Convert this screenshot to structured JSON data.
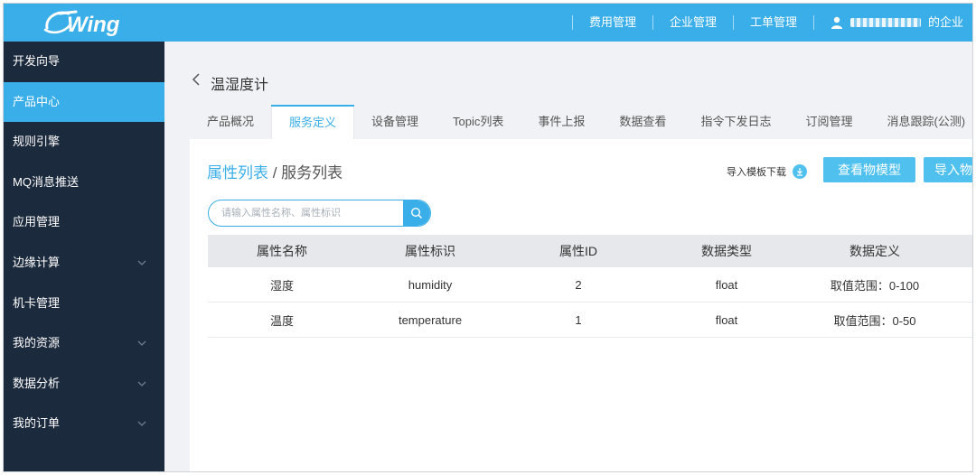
{
  "brand": {
    "logo_text": "Wing",
    "accent": "#3aaee8",
    "sidebar_bg": "#1c2a3d"
  },
  "topnav": {
    "items": [
      "费用管理",
      "企业管理",
      "工单管理"
    ],
    "user_suffix": "的企业"
  },
  "sidebar": {
    "items": [
      {
        "label": "开发向导",
        "expandable": false
      },
      {
        "label": "产品中心",
        "expandable": false,
        "active": true
      },
      {
        "label": "规则引擎",
        "expandable": false
      },
      {
        "label": "MQ消息推送",
        "expandable": false
      },
      {
        "label": "应用管理",
        "expandable": false
      },
      {
        "label": "边缘计算",
        "expandable": true
      },
      {
        "label": "机卡管理",
        "expandable": false
      },
      {
        "label": "我的资源",
        "expandable": true
      },
      {
        "label": "数据分析",
        "expandable": true
      },
      {
        "label": "我的订单",
        "expandable": true
      }
    ]
  },
  "page": {
    "title": "温湿度计",
    "tabs": [
      "产品概况",
      "服务定义",
      "设备管理",
      "Topic列表",
      "事件上报",
      "数据查看",
      "指令下发日志",
      "订阅管理",
      "消息跟踪(公测)"
    ],
    "active_tab": "服务定义"
  },
  "panel": {
    "crumb_link": "属性列表",
    "crumb_sep": " / ",
    "crumb_current": "服务列表",
    "download_label": "导入模板下载",
    "btn_model": "查看物模型",
    "btn_import": "导入物",
    "search_placeholder": "请输入属性名称、属性标识"
  },
  "table": {
    "headers": [
      "属性名称",
      "属性标识",
      "属性ID",
      "数据类型",
      "数据定义"
    ],
    "rows": [
      [
        "湿度",
        "humidity",
        "2",
        "float",
        "取值范围：0-100"
      ],
      [
        "温度",
        "temperature",
        "1",
        "float",
        "取值范围：0-50"
      ]
    ]
  }
}
